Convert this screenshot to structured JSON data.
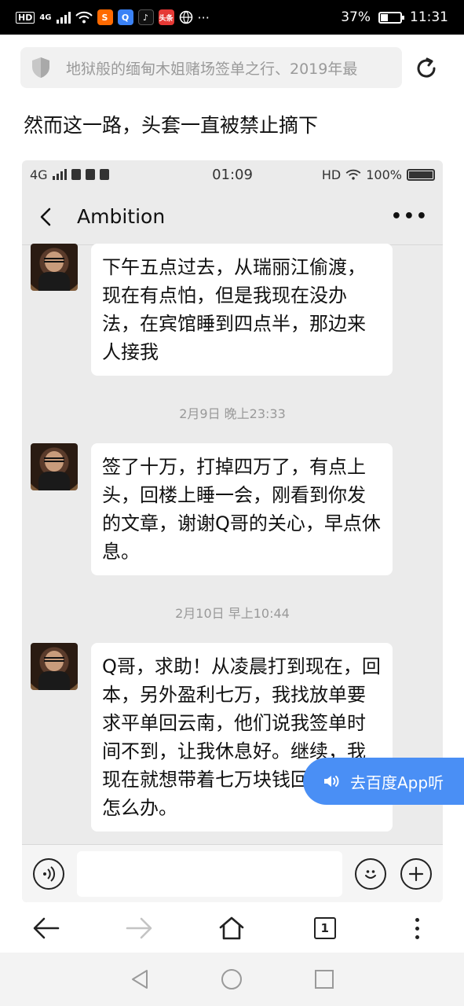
{
  "status_bar": {
    "hd_label": "HD",
    "network": "4G",
    "app_icons": [
      {
        "name": "taobao-icon",
        "letter": "S",
        "color": "#ff6a00"
      },
      {
        "name": "baidu-app-icon",
        "letter": "Q",
        "color": "#3b82f6"
      },
      {
        "name": "douyin-icon",
        "letter": "♪",
        "color": "#111111"
      },
      {
        "name": "toutiao-icon",
        "letter": "头条",
        "color": "#e53935"
      }
    ],
    "battery_percent": "37%",
    "time": "11:31"
  },
  "address_bar": {
    "title": "地狱般的缅甸木姐赌场签单之行、2019年最"
  },
  "article": {
    "text": "然而这一路，头套一直被禁止摘下"
  },
  "chat": {
    "status": {
      "network": "4G",
      "time": "01:09",
      "hd": "HD",
      "battery": "100%"
    },
    "title": "Ambition",
    "messages": [
      {
        "text": "下午五点过去，从瑞丽江偷渡，现在有点怕，但是我现在没办法，在宾馆睡到四点半，那边来人接我"
      },
      {
        "text": "签了十万，打掉四万了，有点上头，回楼上睡一会，刚看到你发的文章，谢谢Q哥的关心，早点休息。"
      },
      {
        "text": "Q哥，求助！从凌晨打到现在，回本，另外盈利七万，我找放单要求平单回云南，他们说我签单时间不到，让我休息好。继续，我现在就想带着七万块钱回，我该怎么办。"
      }
    ],
    "timestamps": [
      "2月9日 晚上23:33",
      "2月10日 早上10:44"
    ]
  },
  "listen_button": {
    "label": "去百度App听"
  },
  "toolbar": {
    "tab_count": "1"
  },
  "colors": {
    "accent": "#4a8ff5",
    "status_bar_bg": "#000000",
    "chat_bg": "#ebebeb"
  }
}
